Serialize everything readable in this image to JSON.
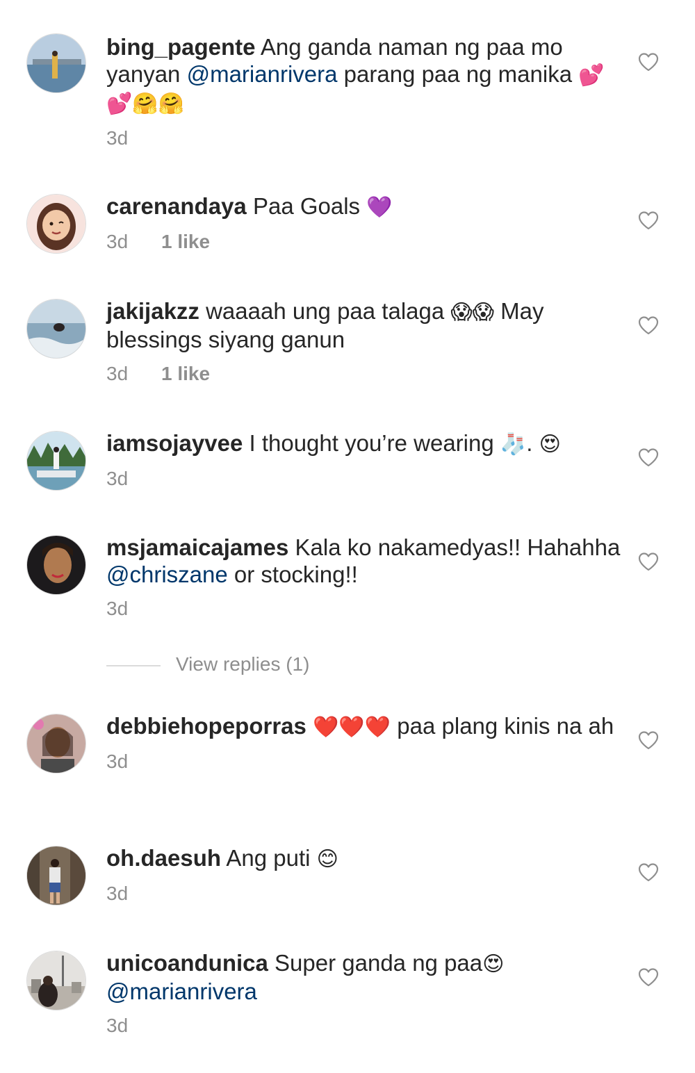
{
  "comments": [
    {
      "username": "bing_pagente",
      "text_1": " Ang ganda naman ng paa mo yanyan ",
      "mention": "@marianrivera",
      "text_2": "  parang paa ng manika ",
      "emoji": "💕💕🤗🤗",
      "time": "3d",
      "likes": ""
    },
    {
      "username": "carenandaya",
      "text_1": " Paa Goals ",
      "emoji": "💜",
      "time": "3d",
      "likes": "1 like"
    },
    {
      "username": "jakijakzz",
      "text_1": " waaaah ung paa talaga ",
      "emoji": "😱😱",
      "text_2": " May blessings siyang ganun",
      "time": "3d",
      "likes": "1 like"
    },
    {
      "username": "iamsojayvee",
      "text_1": " I thought you’re wearing ",
      "emoji": "🧦",
      "text_2": ". ",
      "emoji_2": "😍",
      "time": "3d",
      "likes": ""
    },
    {
      "username": "msjamaicajames",
      "text_1": " Kala ko nakamedyas!! Hahahha ",
      "mention": "@chriszane",
      "text_2": "  or stocking!!",
      "time": "3d",
      "likes": ""
    },
    {
      "username": "debbiehopeporras",
      "text_1": " ",
      "emoji": "❤️❤️❤️",
      "text_2": " paa  plang  kinis na ah",
      "time": "3d",
      "likes": ""
    },
    {
      "username": "oh.daesuh",
      "text_1": " Ang puti ",
      "emoji": "😊",
      "time": "3d",
      "likes": ""
    },
    {
      "username": "unicoandunica",
      "text_1": " Super ganda ng paa",
      "emoji": "😍",
      "mention": "@marianrivera",
      "time": "3d",
      "likes": ""
    }
  ],
  "view_replies": "View replies (1)",
  "icons": {
    "like": "heart-outline-icon"
  },
  "colors": {
    "text": "#262626",
    "muted": "#8e8e8e",
    "mention": "#00376b"
  }
}
